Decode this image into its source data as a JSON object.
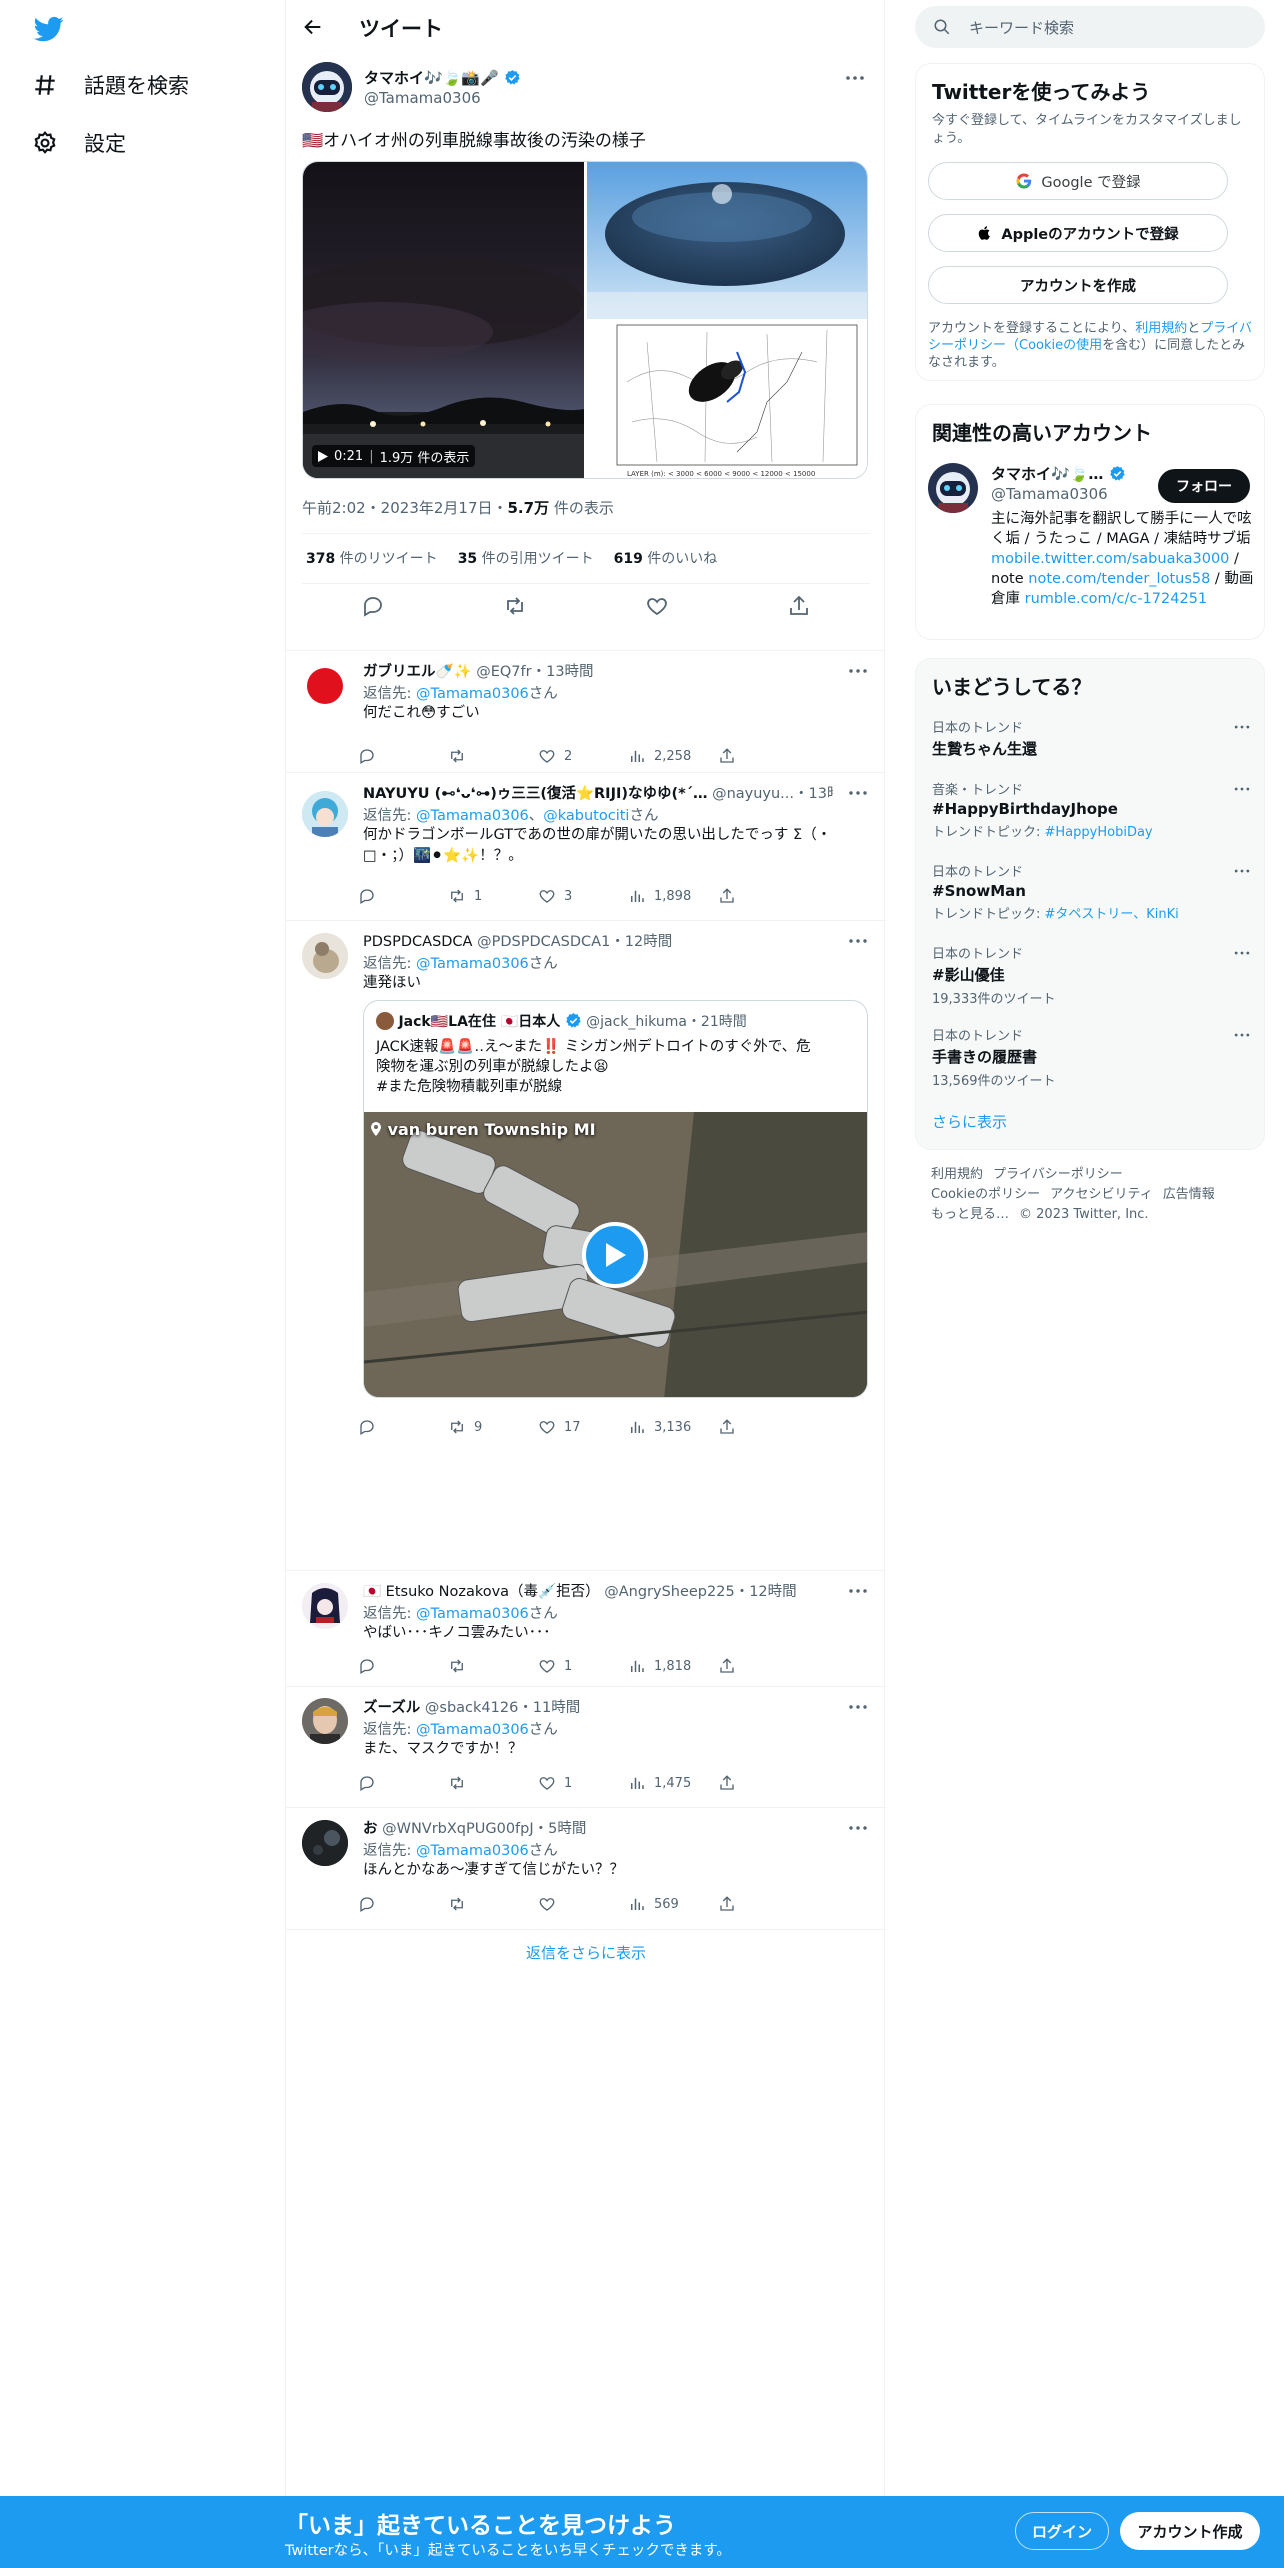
{
  "nav": {
    "explore_label": "話題を検索",
    "settings_label": "設定"
  },
  "header": {
    "title": "ツイート"
  },
  "tweet": {
    "name": "タマホイ🎶🍃📸🎤",
    "handle": "@Tamama0306",
    "text": "🇺🇸オハイオ州の列車脱線事故後の汚染の様子",
    "video_time": "0:21",
    "video_views": "1.9万 件の表示",
    "time": "午前2:02・2023年2月17日・",
    "views_count": "5.7万",
    "views_label": " 件の表示",
    "retweets_count": "378",
    "retweets_label": " 件のリツイート",
    "quotes_count": "35",
    "quotes_label": " 件の引用ツイート",
    "likes_count": "619",
    "likes_label": " 件のいいね",
    "map_legend": "LAYER (m):  < 3000   < 6000   < 9000   < 12000   < 15000"
  },
  "replies": [
    {
      "name": "ガブリエル🍼✨",
      "handle": "@EQ7fr",
      "time": "・13時間",
      "to_label": "返信先: ",
      "to": "@Tamama0306",
      "to2": "",
      "to_suffix": "さん",
      "text": "何だこれ😳すごい",
      "retweets": "",
      "likes": "2",
      "views": "2,258"
    },
    {
      "name": "NAYUYU (⊷❛ᴗ❛⊶)ゥ三三(復活⭐RIJI)なゆゆ(*´…",
      "handle": "@nayuyu...",
      "time": "・13時間",
      "to_label": "返信先: ",
      "to": "@Tamama0306",
      "to2": "@kabutociti",
      "to_suffix": "さん",
      "text": "何かドラゴンボールGTであの世の扉が開いたの思い出したでっす Σ（・□・；）🌃⚫⭐✨！？。",
      "retweets": "1",
      "likes": "3",
      "views": "1,898"
    },
    {
      "name": "PDSPDCASDCA",
      "handle": "@PDSPDCASDCA1",
      "time": "・12時間",
      "to_label": "返信先: ",
      "to": "@Tamama0306",
      "to2": "",
      "to_suffix": "さん",
      "text": "連発ほい",
      "retweets": "9",
      "likes": "17",
      "views": "3,136"
    },
    {
      "name": "🇯🇵 Etsuko Nozakova（毒💉拒否）",
      "handle": "@AngrySheep225",
      "time": "・12時間",
      "to_label": "返信先: ",
      "to": "@Tamama0306",
      "to2": "",
      "to_suffix": "さん",
      "text": "やばい･･･キノコ雲みたい･･･",
      "retweets": "",
      "likes": "1",
      "views": "1,818"
    },
    {
      "name": "ズーズル",
      "handle": "@sback4126",
      "time": "・11時間",
      "to_label": "返信先: ",
      "to": "@Tamama0306",
      "to2": "",
      "to_suffix": "さん",
      "text": "また、マスクですか！？",
      "retweets": "",
      "likes": "1",
      "views": "1,475"
    },
    {
      "name": "お",
      "handle": "@WNVrbXqPUG00fpJ",
      "time": "・5時間",
      "to_label": "返信先: ",
      "to": "@Tamama0306",
      "to2": "",
      "to_suffix": "さん",
      "text": "ほんとかなあ〜凄すぎて信じがたい？？",
      "retweets": "",
      "likes": "",
      "views": "569"
    }
  ],
  "quote": {
    "name": "Jack🇺🇸LA在住 🇯🇵日本人",
    "handle": "@jack_hikuma",
    "time": "・21時間",
    "line1": "JACK速報🚨🚨‥え〜また‼️ ミシガン州デトロイトのすぐ外で、危",
    "line2": "険物を運ぶ別の列車が脱線したよ😫",
    "line3": "#また危険物積載列車が脱線",
    "location": "van buren Township MI"
  },
  "show_more_replies": "返信をさらに表示",
  "right": {
    "search_placeholder": "キーワード検索",
    "signup_title": "Twitterを使ってみよう",
    "signup_sub": "今すぐ登録して、タイムラインをカスタマイズしましょう。",
    "google_btn": "Google で登録",
    "apple_btn": "Appleのアカウントで登録",
    "create_btn": "アカウントを作成",
    "terms_1": "アカウントを登録することにより、",
    "terms_link1": "利用規約",
    "terms_2": "と",
    "terms_link2": "プライバシーポリシー（Cookieの使用",
    "terms_3": "を含む）に同意したとみなされます。",
    "related_title": "関連性の高いアカウント",
    "related_name": "タマホイ🎶🍃…",
    "related_handle": "@Tamama0306",
    "follow_btn": "フォロー",
    "related_bio1": "主に海外記事を翻訳して勝手に一人で呟く垢 / うたっこ / MAGA / 凍結時サブ垢",
    "related_link1": "mobile.twitter.com/sabuaka3000",
    "related_bio2": " / note ",
    "related_link2": "note.com/tender_lotus58",
    "related_bio3": " / 動画倉庫 ",
    "related_link3": "rumble.com/c/c-1724251",
    "trends_title": "いまどうしてる？",
    "trends": [
      {
        "category": "日本のトレンド",
        "name": "生贄ちゃん生還",
        "extra_label": "",
        "extra_link": ""
      },
      {
        "category": "音楽・トレンド",
        "name": "#HappyBirthdayJhope",
        "extra_label": "トレンドトピック: ",
        "extra_link": "#HappyHobiDay"
      },
      {
        "category": "日本のトレンド",
        "name": "#SnowMan",
        "extra_label": "トレンドトピック: ",
        "extra_link": "#タペストリー、KinKi"
      },
      {
        "category": "日本のトレンド",
        "name": "#影山優佳",
        "extra_label": "19,333件のツイート",
        "extra_link": ""
      },
      {
        "category": "日本のトレンド",
        "name": "手書きの履歴書",
        "extra_label": "13,569件のツイート",
        "extra_link": ""
      }
    ],
    "show_more": "さらに表示",
    "footer_links": [
      "利用規約",
      "プライバシーポリシー",
      "Cookieのポリシー",
      "アクセシビリティ",
      "広告情報",
      "もっと見る…",
      "© 2023 Twitter, Inc."
    ]
  },
  "bottom": {
    "title": "「いま」起きていることを見つけよう",
    "sub": "Twitterなら、「いま」起きていることをいち早くチェックできます。",
    "login": "ログイン",
    "signup": "アカウント作成"
  },
  "colors": {
    "accent": "#1d9bf0",
    "text": "#0f1419",
    "muted": "#536471"
  }
}
